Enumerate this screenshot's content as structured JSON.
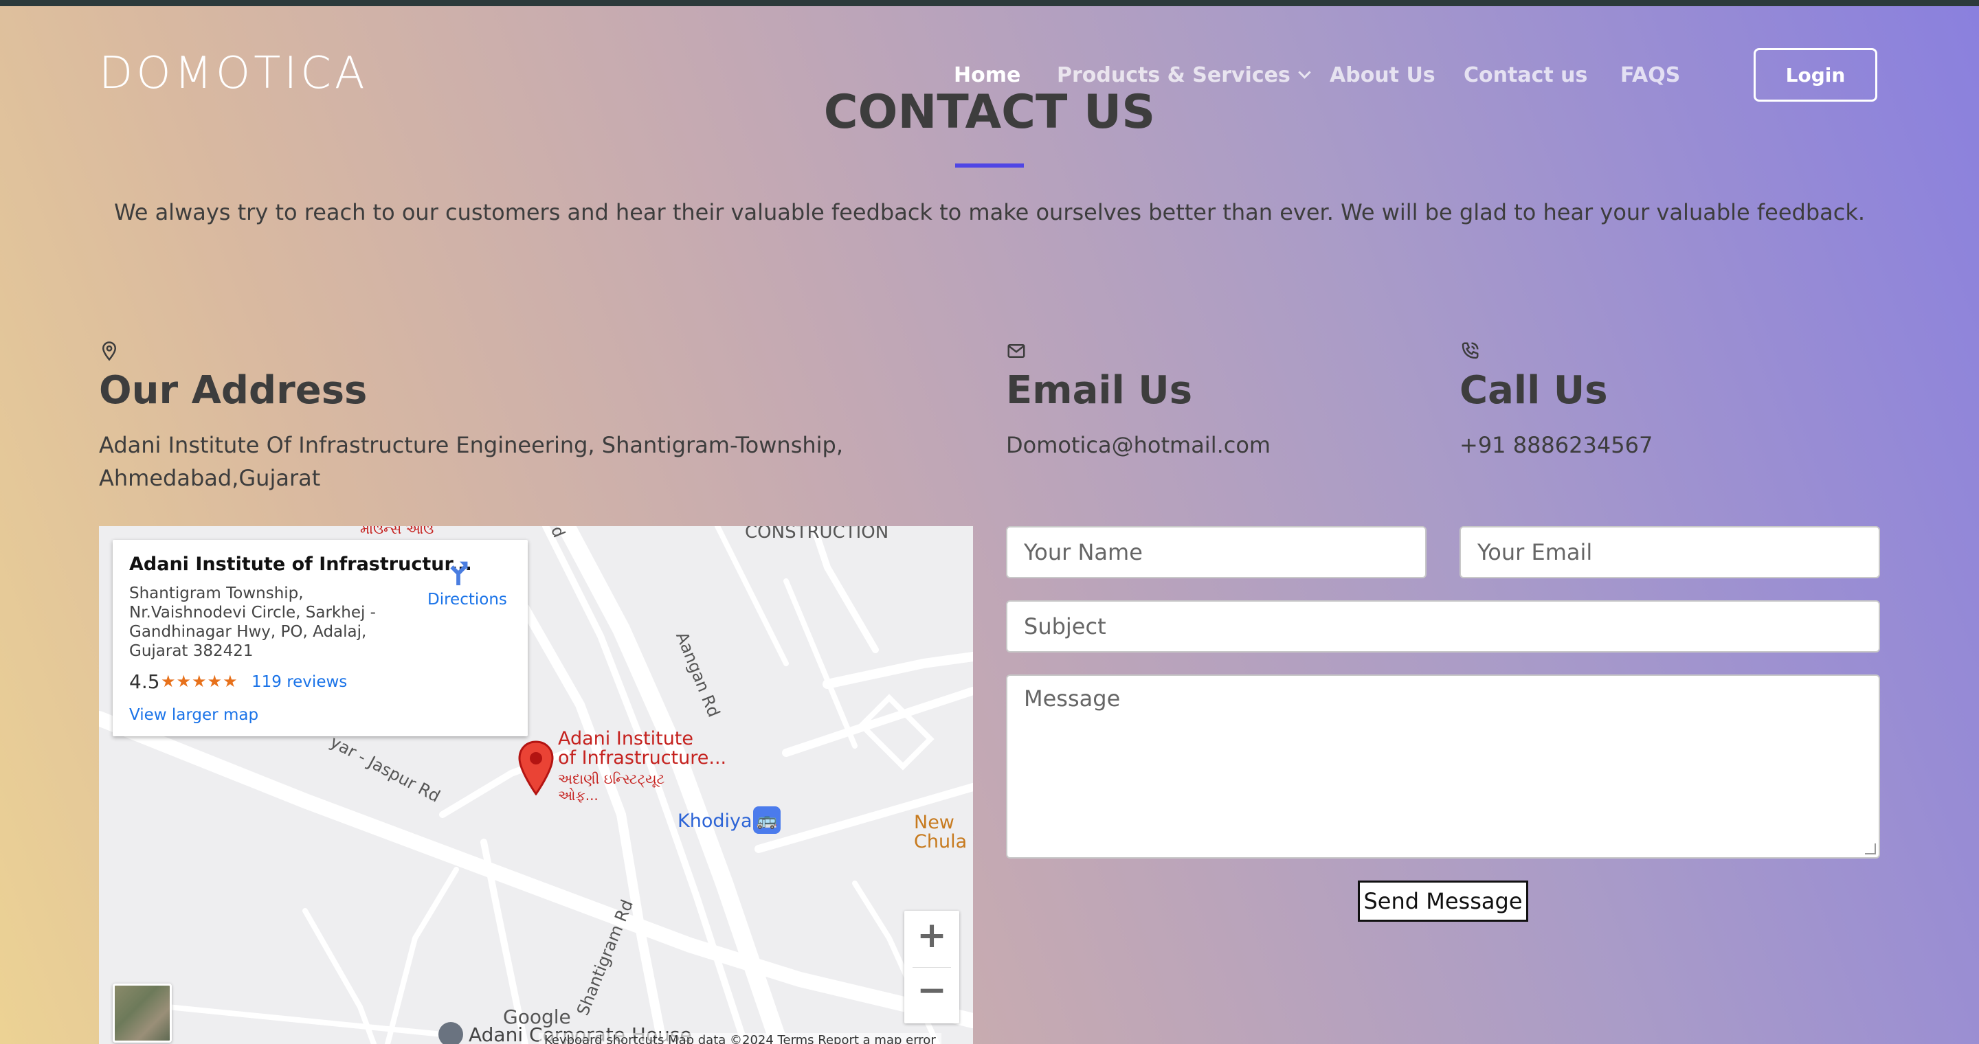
{
  "brand": {
    "logo": "DOMOTICA"
  },
  "nav": {
    "items": [
      "Home",
      "Products & Services",
      "About Us",
      "Contact us",
      "FAQS"
    ],
    "active": "Home",
    "login_label": "Login"
  },
  "page": {
    "title": "CONTACT US",
    "intro": "We always try to reach to our customers and hear their valuable feedback to make ourselves better than ever. We will be glad to hear your valuable feedback.",
    "accent_color": "#4f46e5"
  },
  "address": {
    "icon": "location-pin-icon",
    "title": "Our Address",
    "line1": "Adani Institute Of Infrastructure Engineering, Shantigram-Township,",
    "line2": "Ahmedabad,Gujarat"
  },
  "email": {
    "icon": "envelope-icon",
    "title": "Email Us",
    "value": "Domotica@hotmail.com"
  },
  "phone": {
    "icon": "phone-icon",
    "title": "Call Us",
    "value": "+91 8886234567"
  },
  "map": {
    "card": {
      "title": "Adani Institute of Infrastructur...",
      "address": "Shantigram Township, Nr.Vaishnodevi Circle, Sarkhej - Gandhinagar Hwy, PO, Adalaj, Gujarat 382421",
      "rating": "4.5",
      "stars": "★★★★★",
      "reviews": "119 reviews",
      "larger_map": "View larger map",
      "directions": "Directions"
    },
    "place_name_1": "Adani Institute",
    "place_name_2": "of Infrastructure...",
    "place_sub_1": "અદાણી ઇન્સ્ટિટ્યૂટ",
    "place_sub_2": "ઓફ...",
    "labels": {
      "construction": "CONSTRUCTION",
      "aangan_rd": "Aangan Rd",
      "jaspur_rd": "yar - Jaspur Rd",
      "shantigram_rd": "Shantigram Rd",
      "top_label": "માઉન્સ આઉ",
      "rd": "d"
    },
    "khodiyar": "Khodiyar",
    "new_chula_1": "New",
    "new_chula_2": "Chula C",
    "corporate_house": "Adani Corporate House",
    "google": "Google",
    "footer": "Keyboard shortcuts    Map data ©2024    Terms    Report a map error",
    "zoom_in": "+",
    "zoom_out": "−"
  },
  "form": {
    "name_placeholder": "Your Name",
    "email_placeholder": "Your Email",
    "subject_placeholder": "Subject",
    "message_placeholder": "Message",
    "send_label": "Send Message"
  }
}
